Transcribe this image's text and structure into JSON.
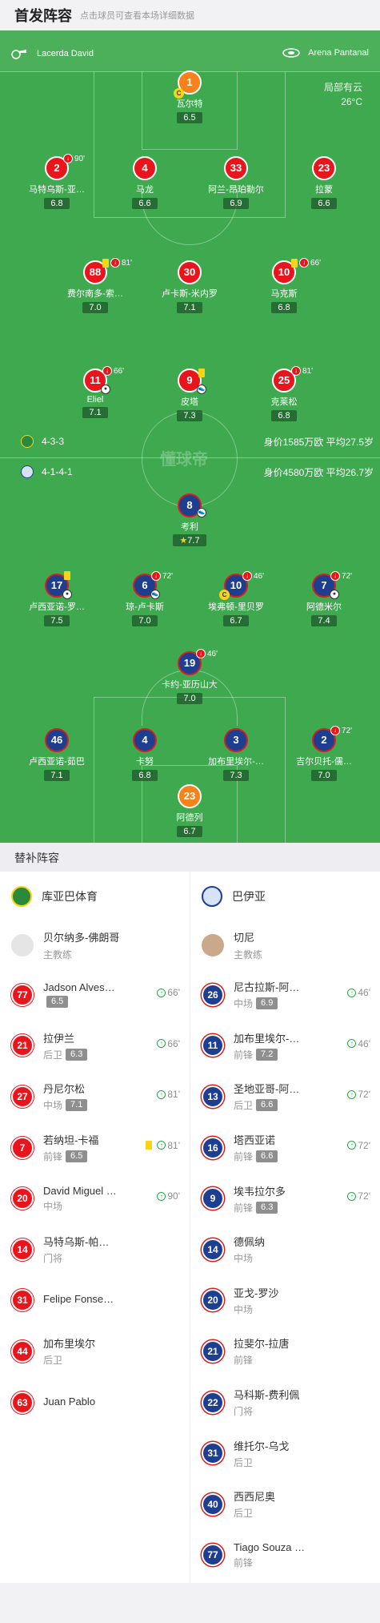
{
  "header": {
    "title": "首发阵容",
    "subtitle": "点击球员可查看本场详细数据"
  },
  "pitch": {
    "home_coach": "Lacerda David",
    "venue": "Arena Pantanal",
    "weather": "局部有云",
    "temp": "26°C",
    "watermark": "懂球帝",
    "home_formation": "4-3-3",
    "home_value": "身价1585万欧 平均27.5岁",
    "away_formation": "4-1-4-1",
    "away_value": "身价4580万欧 平均26.7岁",
    "home_players": [
      {
        "num": "1",
        "name": "瓦尔特",
        "rate": "6.5"
      },
      {
        "num": "2",
        "name": "马特乌斯-亚…",
        "rate": "6.8",
        "sub": "90'"
      },
      {
        "num": "4",
        "name": "马龙",
        "rate": "6.6"
      },
      {
        "num": "33",
        "name": "阿兰-昂珀勒尔",
        "rate": "6.9"
      },
      {
        "num": "23",
        "name": "拉蒙",
        "rate": "6.6"
      },
      {
        "num": "88",
        "name": "费尔南多-索…",
        "rate": "7.0",
        "sub": "81'"
      },
      {
        "num": "30",
        "name": "卢卡斯-米内罗",
        "rate": "7.1"
      },
      {
        "num": "10",
        "name": "马克斯",
        "rate": "6.8",
        "sub": "66'"
      },
      {
        "num": "11",
        "name": "Eliel",
        "rate": "7.1",
        "sub": "66'"
      },
      {
        "num": "9",
        "name": "皮塔",
        "rate": "7.3"
      },
      {
        "num": "25",
        "name": "克莱松",
        "rate": "6.8",
        "sub": "81'"
      }
    ],
    "away_players": [
      {
        "num": "8",
        "name": "考利",
        "rate": "7.7"
      },
      {
        "num": "17",
        "name": "卢西亚诺-罗…",
        "rate": "7.5"
      },
      {
        "num": "6",
        "name": "琼-卢卡斯",
        "rate": "7.0",
        "sub": "72'"
      },
      {
        "num": "10",
        "name": "埃弗顿-里贝罗",
        "rate": "6.7",
        "sub": "46'"
      },
      {
        "num": "7",
        "name": "阿德米尔",
        "rate": "7.4",
        "sub": "72'"
      },
      {
        "num": "19",
        "name": "卡约-亚历山大",
        "rate": "7.0",
        "sub": "46'"
      },
      {
        "num": "46",
        "name": "卢西亚诺-茹巴",
        "rate": "7.1"
      },
      {
        "num": "4",
        "name": "卡努",
        "rate": "6.8"
      },
      {
        "num": "3",
        "name": "加布里埃尔-…",
        "rate": "7.3"
      },
      {
        "num": "2",
        "name": "吉尔贝托-儒…",
        "rate": "7.0",
        "sub": "72'"
      },
      {
        "num": "23",
        "name": "阿德列",
        "rate": "6.7"
      }
    ]
  },
  "bench": {
    "title": "替补阵容",
    "home": {
      "team": "库亚巴体育",
      "coach": "贝尔纳多-佛朗哥",
      "coach_role": "主教练",
      "players": [
        {
          "num": "77",
          "name": "Jadson Alves…",
          "pos": "",
          "rate": "6.5",
          "sub": "66'"
        },
        {
          "num": "21",
          "name": "拉伊兰",
          "pos": "后卫",
          "rate": "6.3",
          "sub": "66'"
        },
        {
          "num": "27",
          "name": "丹尼尔松",
          "pos": "中场",
          "rate": "7.1",
          "sub": "81'"
        },
        {
          "num": "7",
          "name": "若纳坦-卡福",
          "pos": "前锋",
          "rate": "6.5",
          "sub": "81'"
        },
        {
          "num": "20",
          "name": "David Miguel …",
          "pos": "中场",
          "rate": "",
          "sub": "90'"
        },
        {
          "num": "14",
          "name": "马特乌斯-帕…",
          "pos": "门将",
          "rate": "",
          "sub": ""
        },
        {
          "num": "31",
          "name": "Felipe Fonse…",
          "pos": "",
          "rate": "",
          "sub": ""
        },
        {
          "num": "44",
          "name": "加布里埃尔",
          "pos": "后卫",
          "rate": "",
          "sub": ""
        },
        {
          "num": "63",
          "name": "Juan Pablo",
          "pos": "",
          "rate": "",
          "sub": ""
        }
      ]
    },
    "away": {
      "team": "巴伊亚",
      "coach": "切尼",
      "coach_role": "主教练",
      "players": [
        {
          "num": "26",
          "name": "尼古拉斯-阿…",
          "pos": "中场",
          "rate": "6.9",
          "sub": "46'"
        },
        {
          "num": "11",
          "name": "加布里埃尔-…",
          "pos": "前锋",
          "rate": "7.2",
          "sub": "46'"
        },
        {
          "num": "13",
          "name": "圣地亚哥-阿…",
          "pos": "后卫",
          "rate": "6.6",
          "sub": "72'"
        },
        {
          "num": "16",
          "name": "塔西亚诺",
          "pos": "前锋",
          "rate": "6.6",
          "sub": "72'"
        },
        {
          "num": "9",
          "name": "埃韦拉尔多",
          "pos": "前锋",
          "rate": "6.3",
          "sub": "72'"
        },
        {
          "num": "14",
          "name": "德佩纳",
          "pos": "中场",
          "rate": "",
          "sub": ""
        },
        {
          "num": "20",
          "name": "亚戈-罗沙",
          "pos": "中场",
          "rate": "",
          "sub": ""
        },
        {
          "num": "21",
          "name": "拉斐尔-拉唐",
          "pos": "前锋",
          "rate": "",
          "sub": ""
        },
        {
          "num": "22",
          "name": "马科斯-费利佩",
          "pos": "门将",
          "rate": "",
          "sub": ""
        },
        {
          "num": "31",
          "name": "维托尔-乌戈",
          "pos": "后卫",
          "rate": "",
          "sub": ""
        },
        {
          "num": "40",
          "name": "西西尼奥",
          "pos": "后卫",
          "rate": "",
          "sub": ""
        },
        {
          "num": "77",
          "name": "Tiago Souza …",
          "pos": "前锋",
          "rate": "",
          "sub": ""
        }
      ]
    }
  }
}
